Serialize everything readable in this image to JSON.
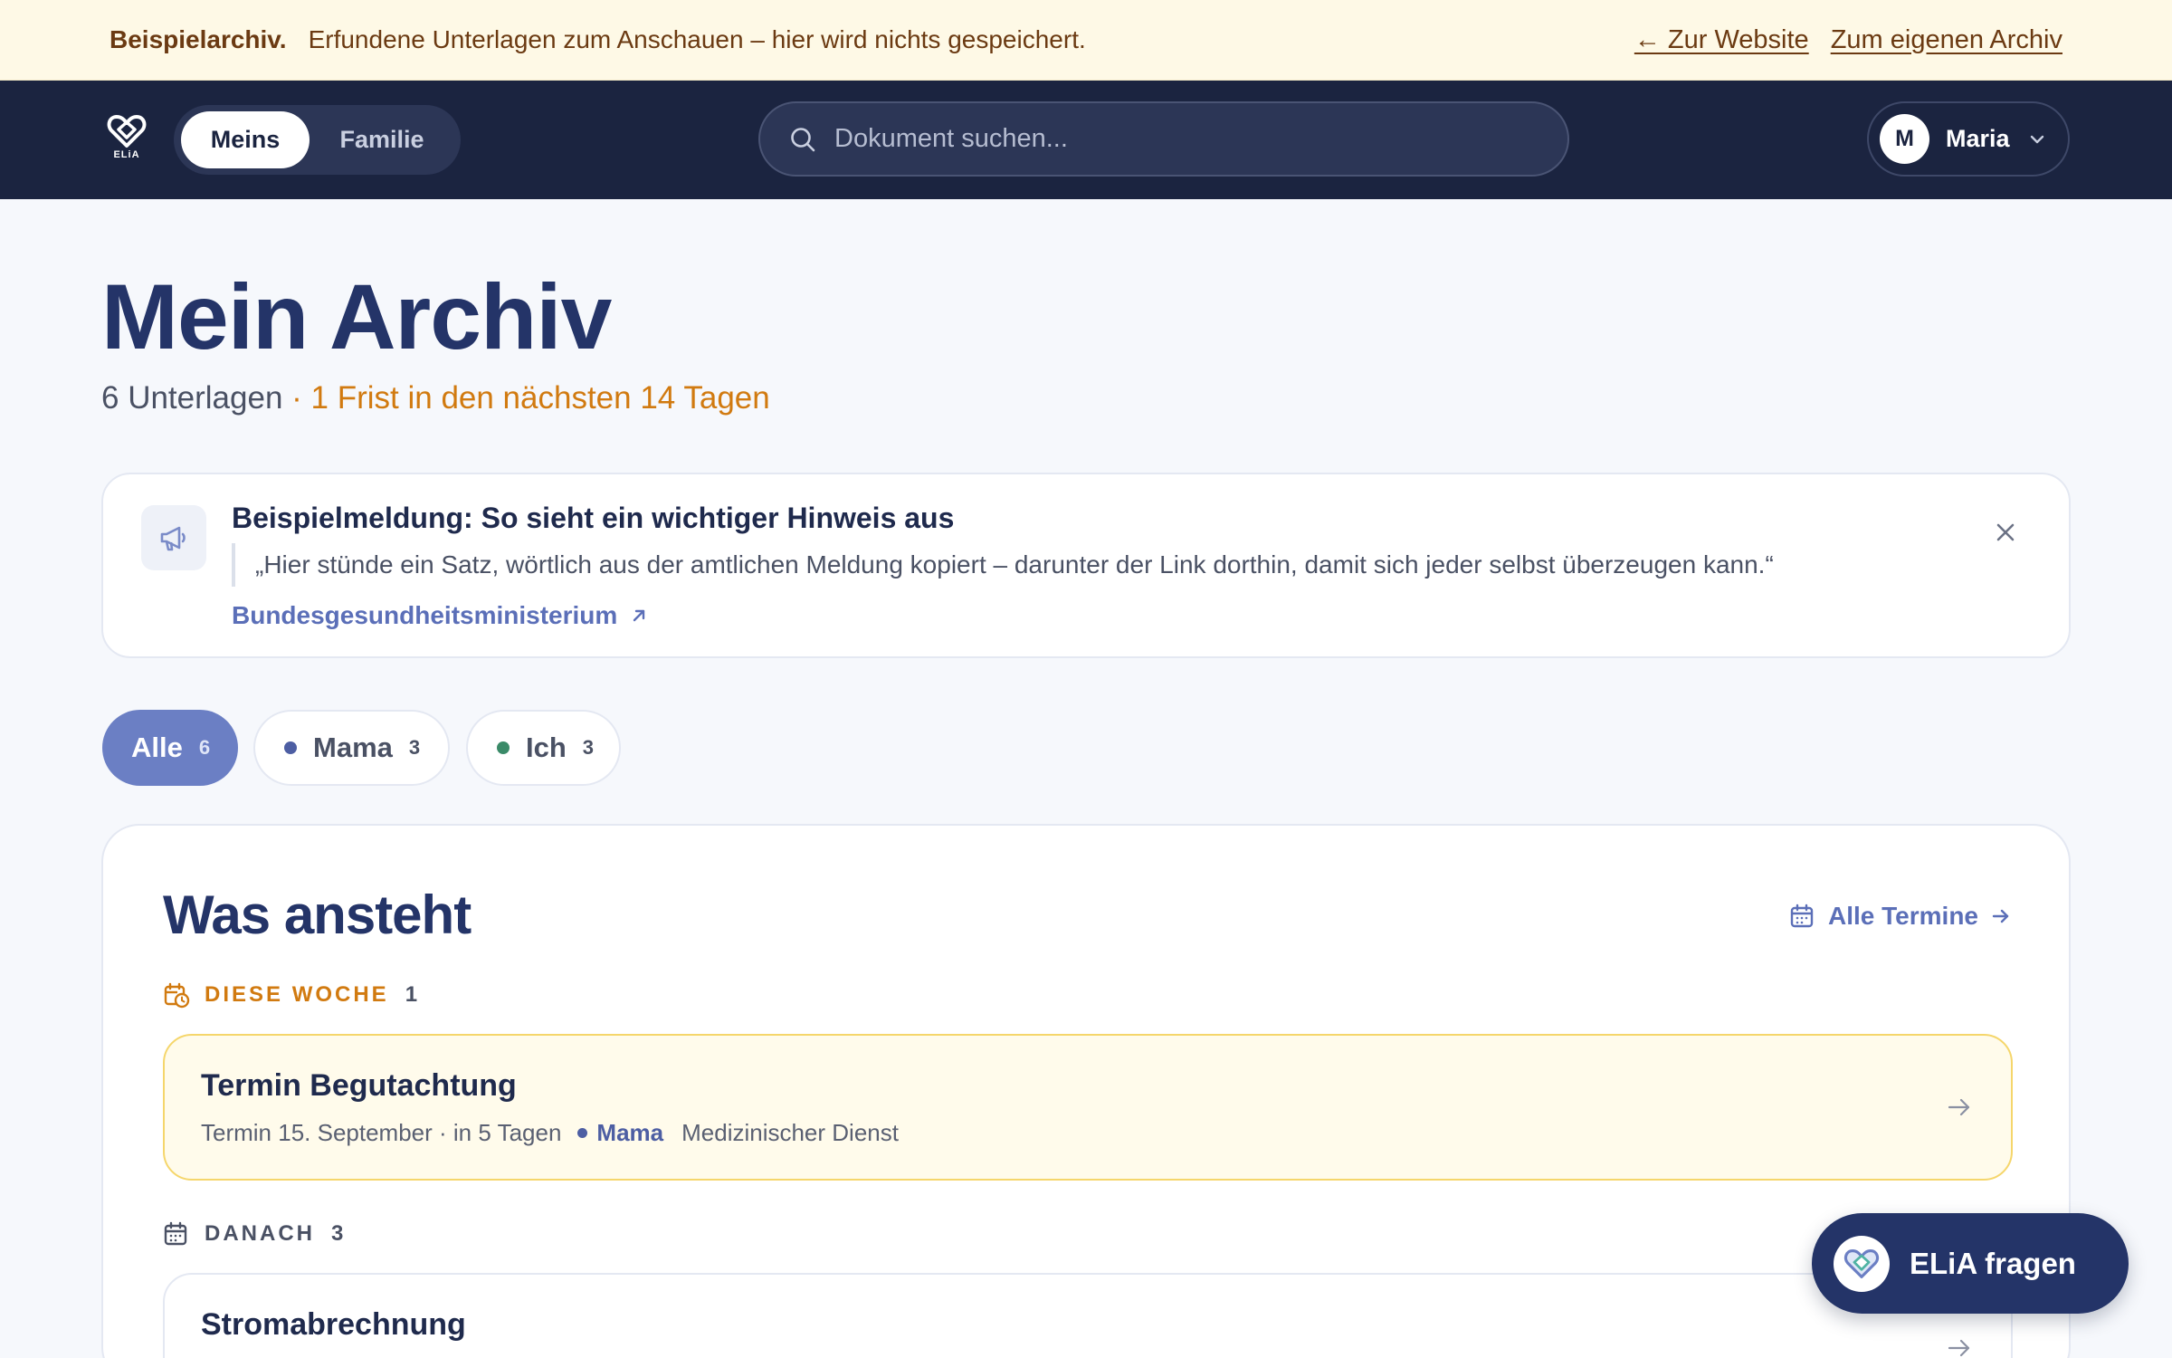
{
  "demo_banner": {
    "title": "Beispielarchiv.",
    "text": "Erfundene Unterlagen zum Anschauen – hier wird nichts gespeichert.",
    "link_website": "← Zur Website",
    "link_own": "Zum eigenen Archiv"
  },
  "header": {
    "logo_text": "ELiA",
    "segment": {
      "active": "Meins",
      "inactive": "Familie"
    },
    "search_placeholder": "Dokument suchen...",
    "user": {
      "initial": "M",
      "name": "Maria"
    }
  },
  "page": {
    "title": "Mein Archiv",
    "count": "6 Unterlagen",
    "deadline": " · 1 Frist in den nächsten 14 Tagen"
  },
  "notice": {
    "title": "Beispielmeldung: So sieht ein wichtiger Hinweis aus",
    "quote": "„Hier stünde ein Satz, wörtlich aus der amtlichen Meldung kopiert – darunter der Link dorthin, damit sich jeder selbst überzeugen kann.“",
    "source": "Bundesgesundheitsministerium"
  },
  "filters": [
    {
      "label": "Alle",
      "count": "6",
      "color": "#6b7fc4"
    },
    {
      "label": "Mama",
      "count": "3",
      "color": "#4d5ea3"
    },
    {
      "label": "Ich",
      "count": "3",
      "color": "#3a8a68"
    }
  ],
  "upcoming": {
    "title": "Was ansteht",
    "all_link": "Alle Termine",
    "week": {
      "heading": "DIESE WOCHE",
      "count": "1",
      "items": [
        {
          "title": "Termin Begutachtung",
          "when": "Termin 15. September · in 5 Tagen",
          "person": "Mama",
          "org": "Medizinischer Dienst"
        }
      ]
    },
    "after": {
      "heading": "DANACH",
      "count": "3",
      "items": [
        {
          "title": "Stromabrechnung"
        }
      ]
    }
  },
  "fab": {
    "label": "ELiA fragen"
  }
}
